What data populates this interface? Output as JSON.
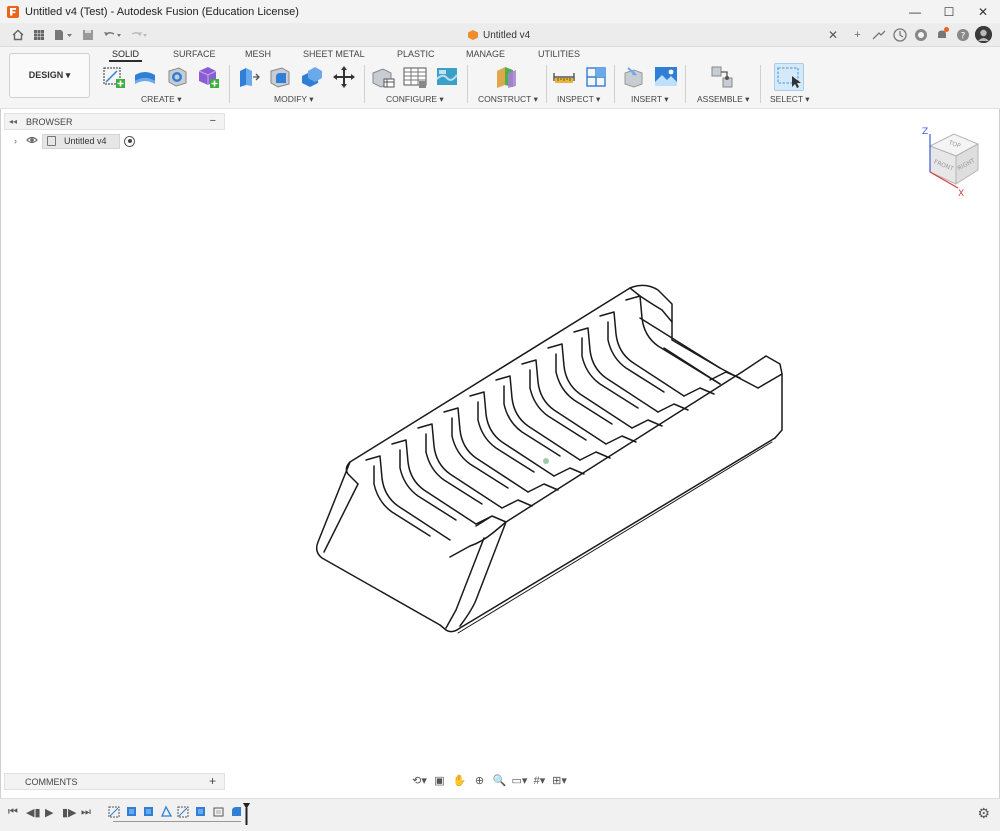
{
  "window": {
    "title": "Untitled v4 (Test) - Autodesk Fusion (Education License)",
    "minimize": "—",
    "maximize": "☐",
    "close": "✕"
  },
  "document_tab": {
    "name": "Untitled v4",
    "close": "✕"
  },
  "workspace": {
    "label": "DESIGN ▾"
  },
  "ribbon_tabs": [
    "SOLID",
    "SURFACE",
    "MESH",
    "SHEET METAL",
    "PLASTIC",
    "MANAGE",
    "UTILITIES"
  ],
  "groups": {
    "create": "CREATE ▾",
    "modify": "MODIFY ▾",
    "configure": "CONFIGURE ▾",
    "construct": "CONSTRUCT ▾",
    "inspect": "INSPECT ▾",
    "insert": "INSERT ▾",
    "assemble": "ASSEMBLE ▾",
    "select": "SELECT ▾"
  },
  "browser": {
    "title": "BROWSER",
    "root_item": "Untitled v4"
  },
  "comments": {
    "title": "COMMENTS"
  },
  "viewcube": {
    "top": "TOP",
    "front": "FRONT",
    "right": "RIGHT",
    "axis_z": "Z",
    "axis_x": "X"
  },
  "colors": {
    "accent_orange": "#e8631c",
    "create_blue": "#2f7fd6",
    "create_green": "#3caf3c",
    "select_highlight": "#5aa6e8"
  }
}
